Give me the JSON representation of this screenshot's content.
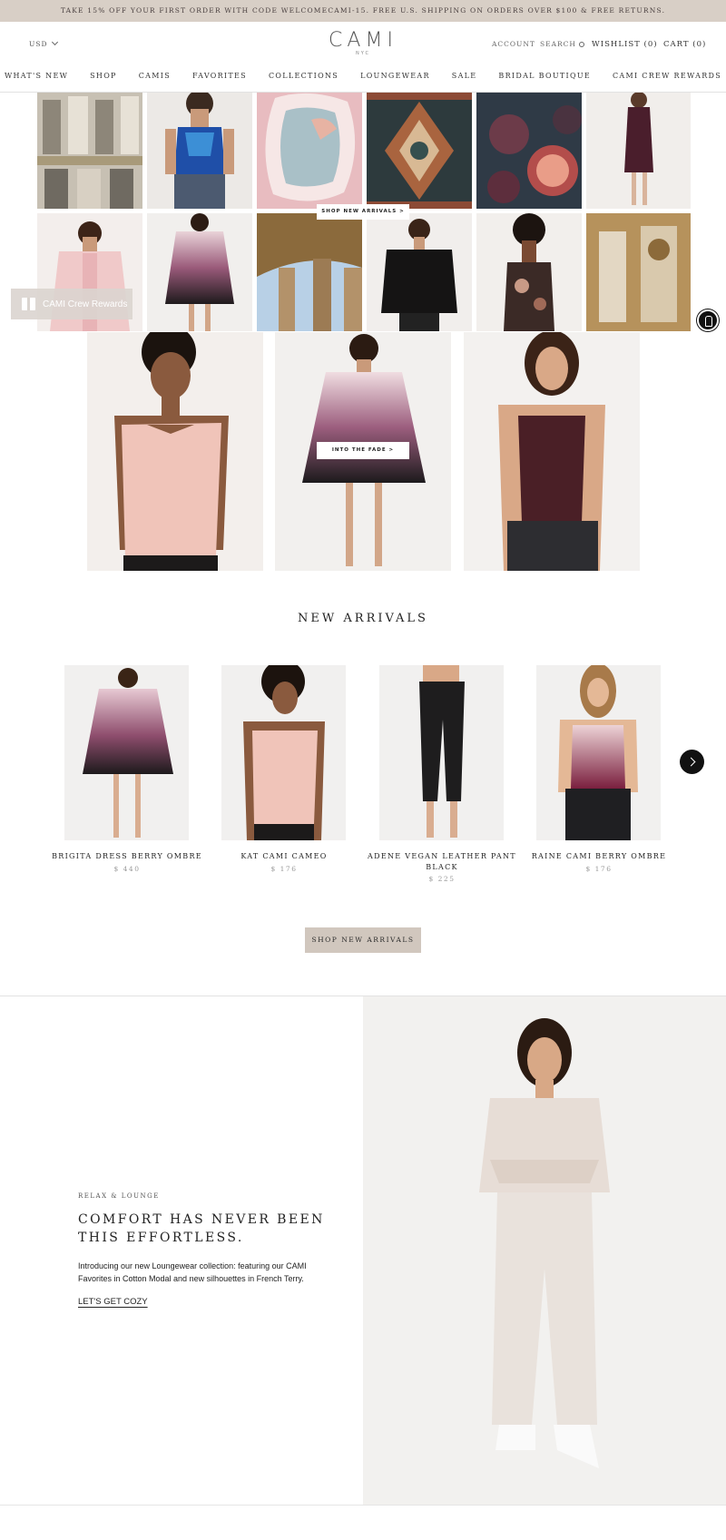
{
  "announcement": "TAKE 15% OFF YOUR FIRST ORDER WITH CODE WELCOMECAMI-15. FREE U.S. SHIPPING ON ORDERS OVER $100 & FREE RETURNS.",
  "header": {
    "currency": "USD",
    "logo": "CAMI",
    "logo_sub": "NYC",
    "account": "ACCOUNT",
    "search": "SEARCH",
    "wishlist": "WISHLIST (0)",
    "cart": "CART (0)"
  },
  "nav": [
    "WHAT'S NEW",
    "SHOP",
    "CAMIS",
    "FAVORITES",
    "COLLECTIONS",
    "LOUNGEWEAR",
    "SALE",
    "BRIDAL BOUTIQUE",
    "CAMI CREW REWARDS"
  ],
  "hero": {
    "grid_button": "SHOP NEW ARRIVALS >",
    "fade_button": "INTO THE FADE >"
  },
  "rewards_widget": "CAMI Crew Rewards",
  "new_arrivals": {
    "title": "NEW ARRIVALS",
    "products": [
      {
        "name": "BRIGITA DRESS BERRY OMBRE",
        "price": "$ 440"
      },
      {
        "name": "KAT CAMI CAMEO",
        "price": "$ 176"
      },
      {
        "name": "ADENE VEGAN LEATHER PANT BLACK",
        "price": "$ 225"
      },
      {
        "name": "RAINE CAMI BERRY OMBRE",
        "price": "$ 176"
      }
    ],
    "button": "SHOP NEW ARRIVALS"
  },
  "lounge": {
    "kicker": "RELAX & LOUNGE",
    "title": "COMFORT HAS NEVER BEEN THIS EFFORTLESS.",
    "text": "Introducing our new Loungewear collection: featuring our CAMI Favorites in Cotton Modal and new silhouettes in French Terry.",
    "link": "LET'S GET COZY"
  },
  "colors": {
    "announcement_bg": "#d8cfc6",
    "button_bg": "#d1c7be",
    "text": "#222222"
  }
}
